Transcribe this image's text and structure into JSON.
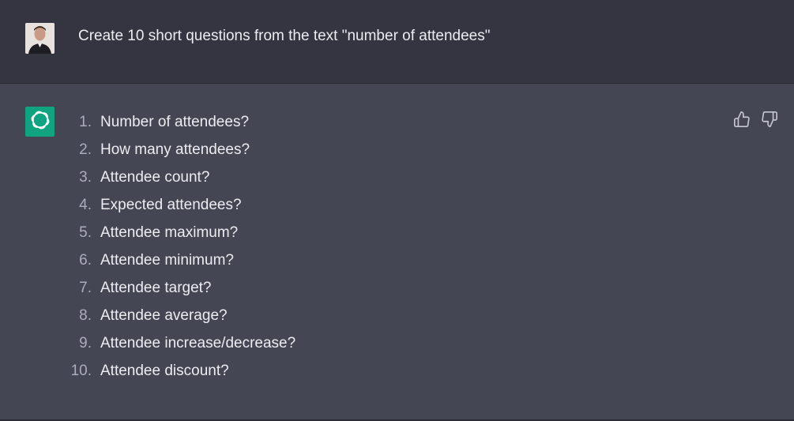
{
  "user_message": {
    "text": "Create 10 short questions from the text \"number of attendees\"",
    "avatar": "user-photo-avatar"
  },
  "assistant_message": {
    "avatar": "openai-logo-icon",
    "avatar_color": "#10a37f",
    "items": [
      {
        "num": "1.",
        "text": "Number of attendees?"
      },
      {
        "num": "2.",
        "text": "How many attendees?"
      },
      {
        "num": "3.",
        "text": "Attendee count?"
      },
      {
        "num": "4.",
        "text": "Expected attendees?"
      },
      {
        "num": "5.",
        "text": "Attendee maximum?"
      },
      {
        "num": "6.",
        "text": "Attendee minimum?"
      },
      {
        "num": "7.",
        "text": "Attendee target?"
      },
      {
        "num": "8.",
        "text": "Attendee average?"
      },
      {
        "num": "9.",
        "text": "Attendee increase/decrease?"
      },
      {
        "num": "10.",
        "text": "Attendee discount?"
      }
    ],
    "feedback": {
      "up_icon": "thumbs-up-icon",
      "down_icon": "thumbs-down-icon"
    }
  },
  "colors": {
    "user_bg": "#343541",
    "assistant_bg": "#444654",
    "text": "#ececf1",
    "list_number": "#acacbe"
  }
}
